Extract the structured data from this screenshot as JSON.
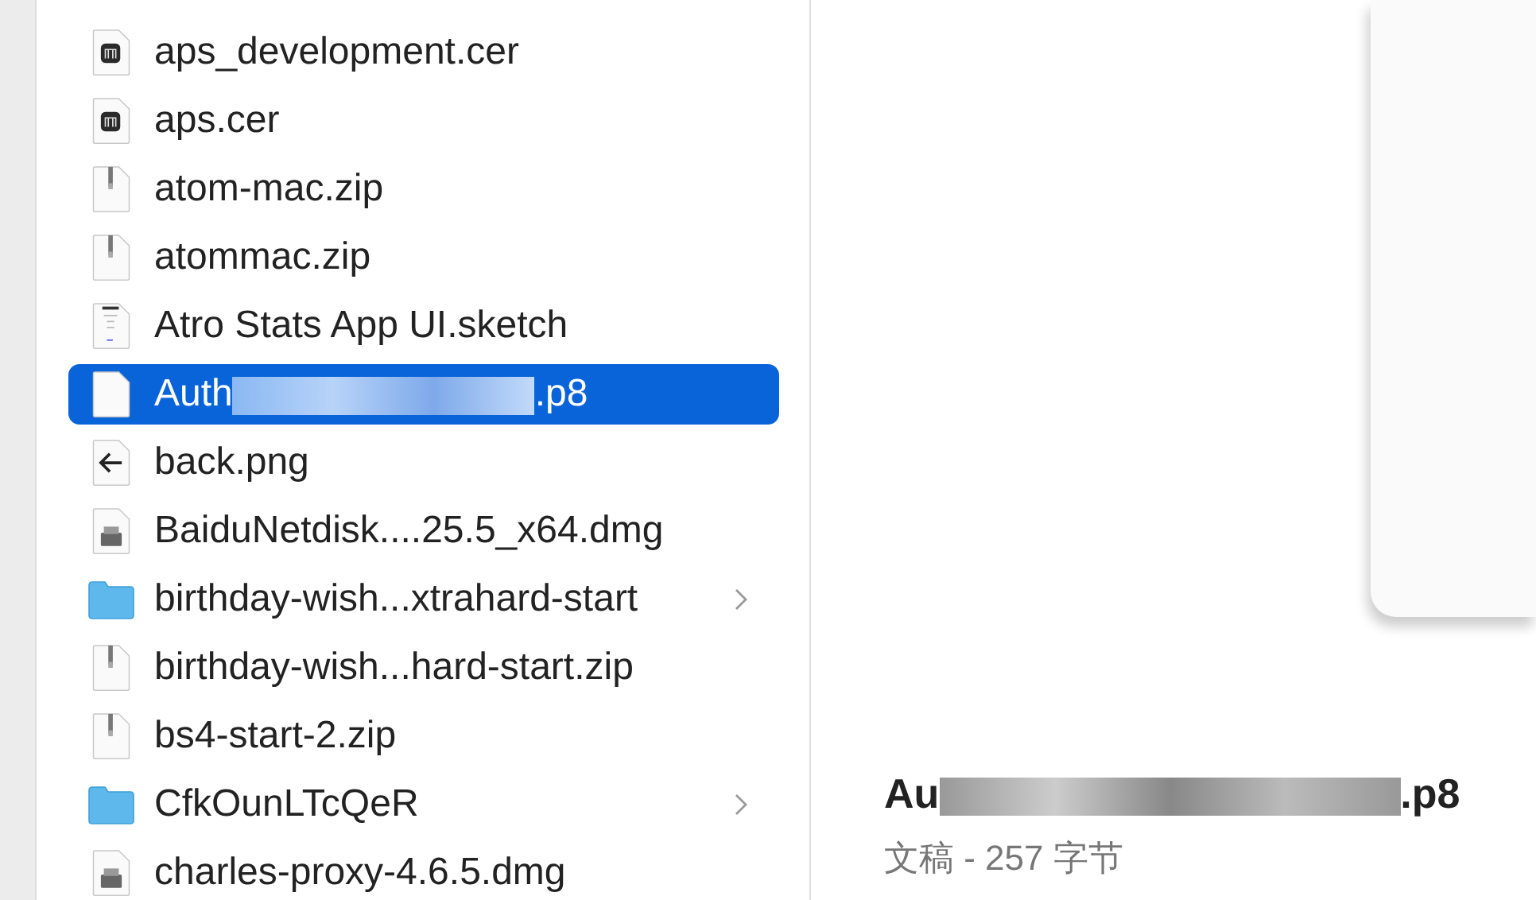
{
  "file_list": [
    {
      "name": "aps_development.cer",
      "kind": "cert",
      "selected": false
    },
    {
      "name": "aps.cer",
      "kind": "cert",
      "selected": false
    },
    {
      "name": "atom-mac.zip",
      "kind": "zip",
      "selected": false
    },
    {
      "name": "atommac.zip",
      "kind": "zip",
      "selected": false
    },
    {
      "name": "Atro Stats App UI.sketch",
      "kind": "sketch",
      "selected": false
    },
    {
      "name": "Auth",
      "name_end": ".p8",
      "redacted": true,
      "kind": "document",
      "selected": true
    },
    {
      "name": "back.png",
      "kind": "image",
      "selected": false
    },
    {
      "name": "BaiduNetdisk....25.5_x64.dmg",
      "kind": "disk-image",
      "selected": false
    },
    {
      "name": "birthday-wish...xtrahard-start",
      "kind": "folder",
      "selected": false
    },
    {
      "name": "birthday-wish...hard-start.zip",
      "kind": "zip",
      "selected": false
    },
    {
      "name": "bs4-start-2.zip",
      "kind": "zip",
      "selected": false
    },
    {
      "name": "CfkOunLTcQeR",
      "kind": "folder",
      "selected": false
    },
    {
      "name": "charles-proxy-4.6.5.dmg",
      "kind": "disk-image",
      "selected": false
    }
  ],
  "preview": {
    "title_start": "Au",
    "title_end": ".p8",
    "title_redacted": true,
    "info": "文稿 - 257 字节"
  }
}
